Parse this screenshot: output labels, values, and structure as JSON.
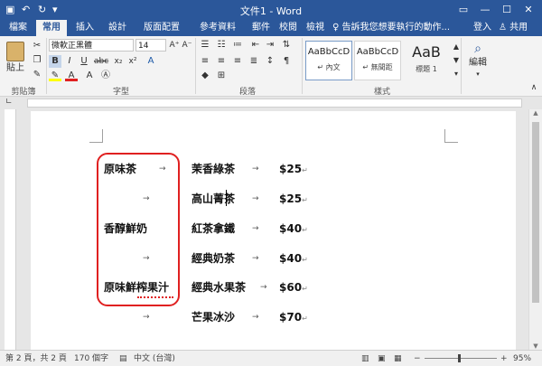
{
  "titlebar": {
    "title": "文件1 - Word",
    "restore_icon": "restore-ribbon-icon",
    "minimize": "—",
    "maximize": "☐",
    "close": "✕"
  },
  "tabs": [
    "檔案",
    "常用",
    "插入",
    "設計",
    "版面配置",
    "參考資料",
    "郵件",
    "校閱",
    "檢視"
  ],
  "active_tab": "常用",
  "tell_me": "♀ 告訴我您想要執行的動作...",
  "account": {
    "login": "登入",
    "share": "共用"
  },
  "ribbon": {
    "clipboard": {
      "paste": "貼上",
      "label": "剪貼簿"
    },
    "font": {
      "name": "微軟正黑體",
      "size": "14",
      "label": "字型"
    },
    "paragraph": {
      "label": "段落"
    },
    "styles": {
      "label": "樣式",
      "items": [
        {
          "sample": "AaBbCcD",
          "name": "↵ 內文"
        },
        {
          "sample": "AaBbCcD",
          "name": "↵ 無間距"
        },
        {
          "sample": "AaB",
          "name": "標題 1"
        }
      ]
    },
    "editing": {
      "label": "編輯"
    }
  },
  "document": {
    "rows": [
      {
        "col1": "原味茶",
        "col2": "茉香綠茶",
        "price": "$25"
      },
      {
        "col1": "",
        "col2": "高山菁茶",
        "price": "$25"
      },
      {
        "col1": "香醇鮮奶",
        "col2": "紅茶拿鐵",
        "price": "$40"
      },
      {
        "col1": "",
        "col2": "經典奶茶",
        "price": "$40"
      },
      {
        "col1": "原味鮮榨果汁",
        "col2": "經典水果茶",
        "price": "$60"
      },
      {
        "col1": "",
        "col2": "芒果冰沙",
        "price": "$70"
      }
    ],
    "tab_arrow": "→",
    "pilcrow": "↵"
  },
  "status": {
    "page": "第 2 頁，共 2 頁",
    "words": "170 個字",
    "language": "中文 (台灣)",
    "zoom": "95%",
    "zoom_minus": "−",
    "zoom_plus": "+"
  },
  "colors": {
    "accent": "#2b579a",
    "highlight_box": "#e02020"
  }
}
